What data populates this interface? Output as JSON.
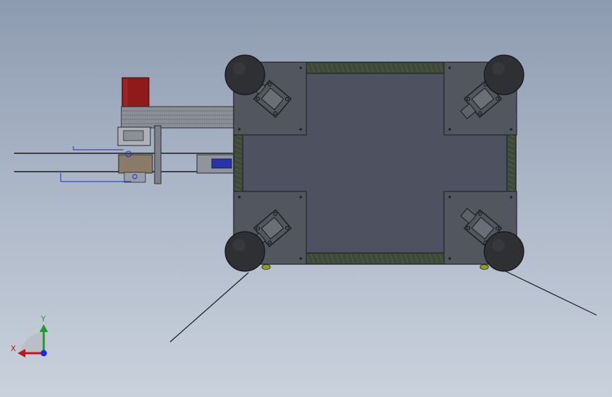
{
  "viewport": {
    "name": "3d-model-viewport",
    "background_top": "#8d9bb0",
    "background_bottom": "#c9d1dc"
  },
  "model": {
    "frame_color": "#52565f",
    "plate_color": "#4e5260",
    "rail_color": "#3d4a3a",
    "wheel_color": "#2f3033",
    "motor_color": "#8e1a1a",
    "dimension_color": "#1d2fc4"
  },
  "triad": {
    "x_label": "X",
    "y_label": "Y",
    "x_color": "#c0161b",
    "y_color": "#1e9b2a",
    "z_color": "#1e2ccf"
  }
}
